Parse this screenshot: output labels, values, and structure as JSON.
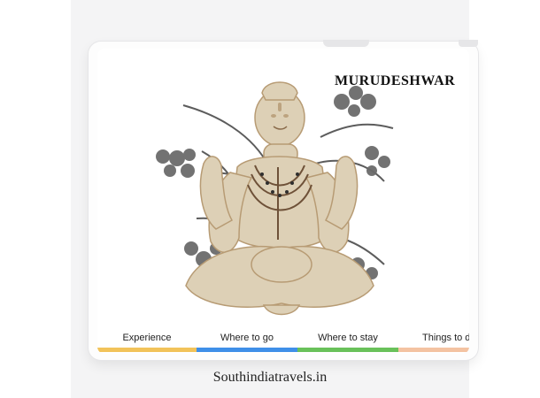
{
  "page": {
    "title": "MURUDESHWAR",
    "footer_text": "Southindiatravels.in"
  },
  "tabs": [
    {
      "label": "Experience",
      "color": "#f2c35a"
    },
    {
      "label": "Where to go",
      "color": "#3f8fe8"
    },
    {
      "label": "Where to stay",
      "color": "#69c15a"
    },
    {
      "label": "Things to do",
      "color": "#f4c3a2"
    }
  ],
  "hero": {
    "subject": "shiva-statue-image"
  }
}
